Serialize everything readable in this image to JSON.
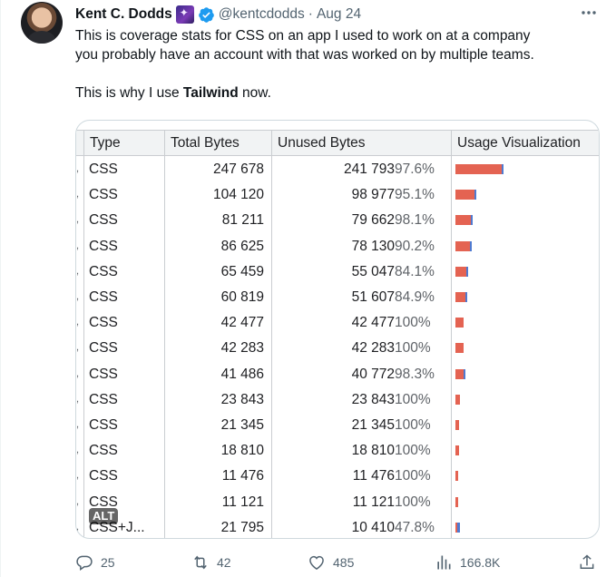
{
  "tweet": {
    "author_name": "Kent C. Dodds",
    "handle": "@kentcdodds",
    "separator": "·",
    "date": "Aug 24",
    "text_line1": "This is coverage stats for CSS on an app I used to work on at a company",
    "text_line2": "you probably have an account with that was worked on by multiple teams.",
    "text_line3_prefix": "This is why I use ",
    "text_line3_bold": "Tailwind",
    "text_line3_suffix": " now."
  },
  "media": {
    "alt_badge": "ALT",
    "headers": {
      "type": "Type",
      "total": "Total Bytes",
      "unused": "Unused Bytes",
      "usage": "Usage Visualization"
    },
    "rows": [
      {
        "type": "CSS",
        "total": "247 678",
        "unused": "241 793",
        "pct": "97.6%",
        "unused_frac": 0.976,
        "size": 1.0
      },
      {
        "type": "CSS",
        "total": "104 120",
        "unused": "98 977",
        "pct": "95.1%",
        "unused_frac": 0.951,
        "size": 0.42
      },
      {
        "type": "CSS",
        "total": "81 211",
        "unused": "79 662",
        "pct": "98.1%",
        "unused_frac": 0.981,
        "size": 0.328
      },
      {
        "type": "CSS",
        "total": "86 625",
        "unused": "78 130",
        "pct": "90.2%",
        "unused_frac": 0.902,
        "size": 0.35
      },
      {
        "type": "CSS",
        "total": "65 459",
        "unused": "55 047",
        "pct": "84.1%",
        "unused_frac": 0.841,
        "size": 0.264
      },
      {
        "type": "CSS",
        "total": "60 819",
        "unused": "51 607",
        "pct": "84.9%",
        "unused_frac": 0.849,
        "size": 0.246
      },
      {
        "type": "CSS",
        "total": "42 477",
        "unused": "42 477",
        "pct": "100%",
        "unused_frac": 1.0,
        "size": 0.172
      },
      {
        "type": "CSS",
        "total": "42 283",
        "unused": "42 283",
        "pct": "100%",
        "unused_frac": 1.0,
        "size": 0.171
      },
      {
        "type": "CSS",
        "total": "41 486",
        "unused": "40 772",
        "pct": "98.3%",
        "unused_frac": 0.983,
        "size": 0.168
      },
      {
        "type": "CSS",
        "total": "23 843",
        "unused": "23 843",
        "pct": "100%",
        "unused_frac": 1.0,
        "size": 0.096
      },
      {
        "type": "CSS",
        "total": "21 345",
        "unused": "21 345",
        "pct": "100%",
        "unused_frac": 1.0,
        "size": 0.086
      },
      {
        "type": "CSS",
        "total": "18 810",
        "unused": "18 810",
        "pct": "100%",
        "unused_frac": 1.0,
        "size": 0.076
      },
      {
        "type": "CSS",
        "total": "11 476",
        "unused": "11 476",
        "pct": "100%",
        "unused_frac": 1.0,
        "size": 0.046
      },
      {
        "type": "CSS",
        "total": "11 121",
        "unused": "11 121",
        "pct": "100%",
        "unused_frac": 1.0,
        "size": 0.045
      },
      {
        "type": "CSS+J...",
        "total": "21 795",
        "unused": "10 410",
        "pct": "47.8%",
        "unused_frac": 0.478,
        "size": 0.088
      }
    ]
  },
  "actions": {
    "replies": "25",
    "reposts": "42",
    "likes": "485",
    "views": "166.8K"
  },
  "colors": {
    "unused_bar": "#e46352",
    "used_bar": "#4f7ad0",
    "verified": "#1d9bf0",
    "muted": "#536471"
  }
}
